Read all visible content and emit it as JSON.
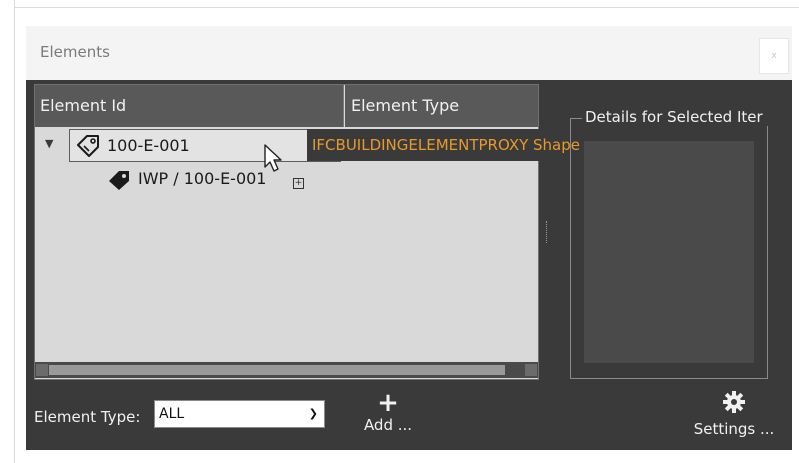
{
  "window": {
    "title": "Elements",
    "close_label": "x"
  },
  "tree": {
    "columns": [
      "Element Id",
      "Element Type"
    ],
    "items": [
      {
        "label": "100-E-001",
        "icon": "tag-outline-icon",
        "expanded": true,
        "selected": true
      },
      {
        "label": "IWP / 100-E-001",
        "icon": "tag-solid-icon"
      }
    ],
    "tooltip": "IFCBUILDINGELEMENTPROXY Shape ..."
  },
  "details": {
    "title": "Details for Selected Iter"
  },
  "footer": {
    "filter_label": "Element Type:",
    "filter_value": "ALL",
    "add_label": "Add ...",
    "settings_label": "Settings ..."
  },
  "colors": {
    "tooltip_text": "#e69a2e",
    "window_bg": "#3a3a3a",
    "tree_bg": "#d9d9d9",
    "header_bg": "#595959"
  }
}
